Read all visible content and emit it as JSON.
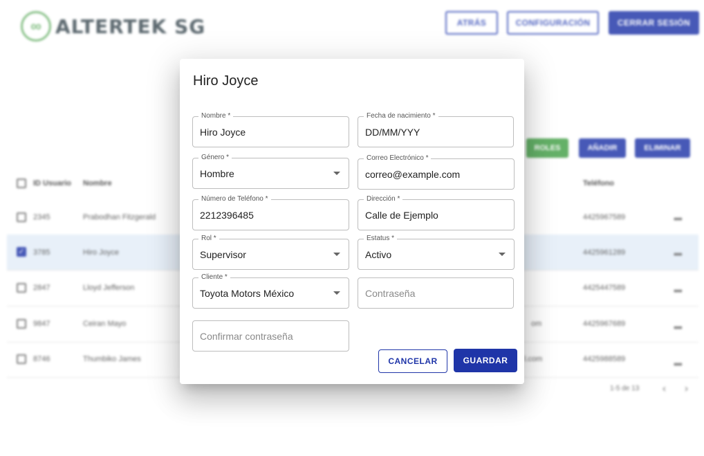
{
  "header": {
    "logo_text": "ALTERTEK SG",
    "buttons": {
      "back": "ATRÁS",
      "settings": "CONFIGURACIÓN",
      "logout": "CERRAR SESIÓN"
    }
  },
  "actions": {
    "roles": "ROLES",
    "add": "AÑADIR",
    "delete": "ELIMINAR"
  },
  "table": {
    "headers": {
      "id": "ID Usuario",
      "name": "Nombre",
      "phone": "Teléfono"
    },
    "rows": [
      {
        "id": "2345",
        "name": "Prabodhan Fitzgerald",
        "email_tail": "",
        "phone": "4425967589",
        "checked": false
      },
      {
        "id": "3785",
        "name": "Hiro Joyce",
        "email_tail": "",
        "phone": "4425961289",
        "checked": true
      },
      {
        "id": "2847",
        "name": "Lloyd Jefferson",
        "email_tail": "",
        "phone": "4425447589",
        "checked": false
      },
      {
        "id": "9847",
        "name": "Ceiran Mayo",
        "email_tail": "om",
        "phone": "4425967689",
        "checked": false
      },
      {
        "id": "8746",
        "name": "Thumbiko James",
        "email_tail": "l.com",
        "phone": "4425988589",
        "checked": false
      }
    ],
    "more_label": "•••",
    "pagination": "1-5 de 13",
    "prev_icon": "‹",
    "next_icon": "›"
  },
  "dialog": {
    "title": "Hiro Joyce",
    "fields": {
      "nombre": {
        "label": "Nombre *",
        "value": "Hiro Joyce"
      },
      "fecha": {
        "label": "Fecha de nacimiento *",
        "value": "DD/MM/YYY"
      },
      "genero": {
        "label": "Género *",
        "value": "Hombre"
      },
      "correo": {
        "label": "Correo Electrónico *",
        "value": "correo@example.com"
      },
      "telefono": {
        "label": "Número de Teléfono *",
        "value": "2212396485"
      },
      "direccion": {
        "label": "Dirección *",
        "value": "Calle de Ejemplo"
      },
      "rol": {
        "label": "Rol *",
        "value": "Supervisor"
      },
      "estatus": {
        "label": "Estatus *",
        "value": "Activo"
      },
      "cliente": {
        "label": "Cliente *",
        "value": "Toyota Motors México"
      },
      "contrasena": {
        "placeholder": "Contraseña"
      },
      "confirmar": {
        "placeholder": "Confirmar contraseña"
      }
    },
    "buttons": {
      "cancel": "CANCELAR",
      "save": "GUARDAR"
    }
  },
  "colors": {
    "primary": "#1f35a8",
    "success": "#43a047",
    "selected_row": "#e3edf8",
    "logo_green": "#6db36d"
  },
  "icons": {
    "logo": "infinity-icon",
    "dropdown": "caret-down-icon",
    "more": "more-horiz-icon",
    "check": "check-icon"
  }
}
